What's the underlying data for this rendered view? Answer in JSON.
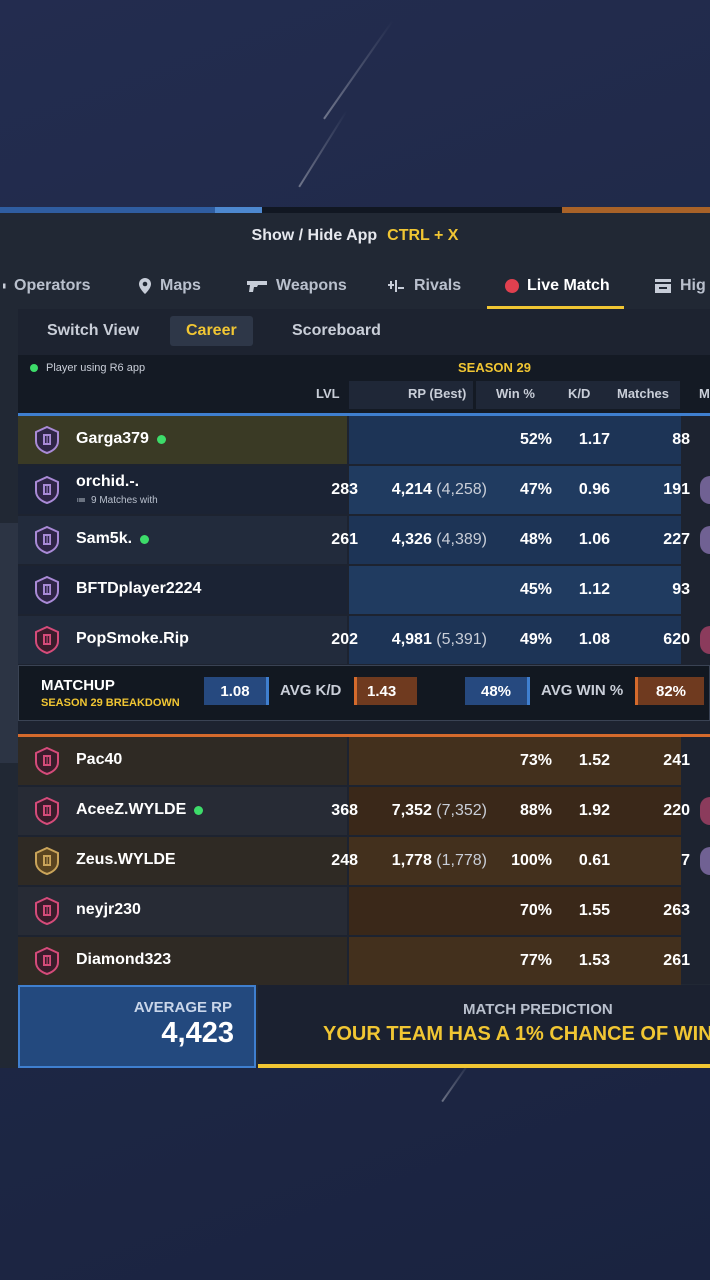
{
  "title_bar": {
    "label": "Show / Hide App",
    "shortcut": "CTRL + X"
  },
  "nav": [
    {
      "label": "Operators",
      "icon": "operators-icon"
    },
    {
      "label": "Maps",
      "icon": "map-pin-icon"
    },
    {
      "label": "Weapons",
      "icon": "gun-icon"
    },
    {
      "label": "Rivals",
      "icon": "versus-icon"
    },
    {
      "label": "Live Match",
      "icon": "live-dot-icon",
      "active": true
    },
    {
      "label": "Hig",
      "icon": "highlights-icon"
    }
  ],
  "switch_view": {
    "label": "Switch View",
    "options": [
      "Career",
      "Scoreboard"
    ],
    "selected": "Career"
  },
  "table": {
    "legend": "Player using R6 app",
    "season": "SEASON 29",
    "headers": {
      "lvl": "LVL",
      "rp": "RP (Best)",
      "win": "Win %",
      "kd": "K/D",
      "matches": "Matches",
      "m": "M"
    },
    "team_blue": [
      {
        "name": "Garga379",
        "online": true,
        "lvl": "",
        "rp": "",
        "best": "",
        "win": "52%",
        "kd": "1.17",
        "matches": "88"
      },
      {
        "name": "orchid.-.",
        "sub": "9 Matches with",
        "lvl": "283",
        "rp": "4,214",
        "best": "(4,258)",
        "win": "47%",
        "kd": "0.96",
        "matches": "191"
      },
      {
        "name": "Sam5k.",
        "online": true,
        "lvl": "261",
        "rp": "4,326",
        "best": "(4,389)",
        "win": "48%",
        "kd": "1.06",
        "matches": "227"
      },
      {
        "name": "BFTDplayer2224",
        "lvl": "",
        "rp": "",
        "best": "",
        "win": "45%",
        "kd": "1.12",
        "matches": "93"
      },
      {
        "name": "PopSmoke.Rip",
        "lvl": "202",
        "rp": "4,981",
        "best": "(5,391)",
        "win": "49%",
        "kd": "1.08",
        "matches": "620"
      }
    ],
    "team_orange": [
      {
        "name": "Pac40",
        "lvl": "",
        "rp": "",
        "best": "",
        "win": "73%",
        "kd": "1.52",
        "matches": "241"
      },
      {
        "name": "AceeZ.WYLDE",
        "online": true,
        "lvl": "368",
        "rp": "7,352",
        "best": "(7,352)",
        "win": "88%",
        "kd": "1.92",
        "matches": "220"
      },
      {
        "name": "Zeus.WYLDE",
        "lvl": "248",
        "rp": "1,778",
        "best": "(1,778)",
        "win": "100%",
        "kd": "0.61",
        "matches": "7"
      },
      {
        "name": "neyjr230",
        "lvl": "",
        "rp": "",
        "best": "",
        "win": "70%",
        "kd": "1.55",
        "matches": "263"
      },
      {
        "name": "Diamond323",
        "lvl": "",
        "rp": "",
        "best": "",
        "win": "77%",
        "kd": "1.53",
        "matches": "261"
      }
    ]
  },
  "matchup": {
    "title": "MATCHUP",
    "subtitle": "SEASON 29 BREAKDOWN",
    "avg_kd_label": "AVG K/D",
    "blue_kd": "1.08",
    "orange_kd": "1.43",
    "avg_win_label": "AVG WIN %",
    "blue_win": "48%",
    "orange_win": "82%"
  },
  "footer": {
    "avg_rp_label": "AVERAGE RP",
    "avg_rp_value": "4,423",
    "prediction_label": "MATCH PREDICTION",
    "prediction_text": "YOUR TEAM HAS A 1% CHANCE OF WIN"
  },
  "colors": {
    "accent": "#f1c633",
    "blue_team": "#3f7fcf",
    "orange_team": "#d46a2c",
    "online": "#3ddc6a",
    "live": "#e0404f"
  }
}
